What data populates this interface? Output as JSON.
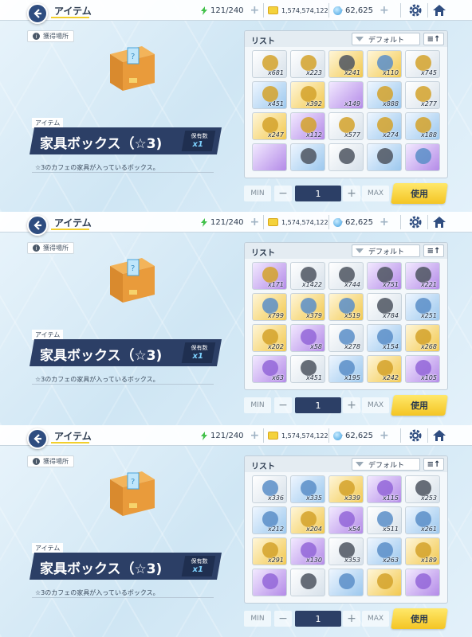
{
  "screens": [
    {
      "title": "アイテム",
      "resources": {
        "ap": "121/240",
        "credits": "1,574,574,122",
        "gems": "62,625"
      },
      "acquisition_label": "獲得場所",
      "item_category": "アイテム",
      "item_name": "家具ボックス（☆3)",
      "owned_label": "保有数",
      "owned_count": "x1",
      "description": "☆3のカフェの家具が入っているボックス。",
      "list_title": "リスト",
      "sort_label": "デフォルト",
      "sort_order_icon": "sort-order-icon",
      "quantity": {
        "min_label": "MIN",
        "max_label": "MAX",
        "value": "1"
      },
      "use_label": "使用",
      "grid": [
        {
          "qty": "x681",
          "tone": "white",
          "glyph": "gold"
        },
        {
          "qty": "x223",
          "tone": "white",
          "glyph": "gold"
        },
        {
          "qty": "x241",
          "tone": "gold",
          "glyph": "dark"
        },
        {
          "qty": "x110",
          "tone": "gold",
          "glyph": "blue"
        },
        {
          "qty": "x745",
          "tone": "white",
          "glyph": "gold"
        },
        {
          "qty": "x451",
          "tone": "blue",
          "glyph": "gold"
        },
        {
          "qty": "x392",
          "tone": "gold",
          "glyph": "gold"
        },
        {
          "qty": "x149",
          "tone": "purple",
          "glyph": "white"
        },
        {
          "qty": "x888",
          "tone": "blue",
          "glyph": "gold"
        },
        {
          "qty": "x277",
          "tone": "white",
          "glyph": "gold"
        },
        {
          "qty": "x247",
          "tone": "gold",
          "glyph": "gold"
        },
        {
          "qty": "x112",
          "tone": "purple",
          "glyph": "gold"
        },
        {
          "qty": "x577",
          "tone": "white",
          "glyph": "gold"
        },
        {
          "qty": "x274",
          "tone": "blue",
          "glyph": "gold"
        },
        {
          "qty": "x188",
          "tone": "blue",
          "glyph": "gold"
        },
        {
          "qty": "",
          "tone": "purple",
          "glyph": "white"
        },
        {
          "qty": "",
          "tone": "blue",
          "glyph": "dark"
        },
        {
          "qty": "",
          "tone": "white",
          "glyph": "dark"
        },
        {
          "qty": "",
          "tone": "blue",
          "glyph": "dark"
        },
        {
          "qty": "",
          "tone": "purple",
          "glyph": "blue"
        }
      ]
    },
    {
      "title": "アイテム",
      "resources": {
        "ap": "121/240",
        "credits": "1,574,574,122",
        "gems": "62,625"
      },
      "acquisition_label": "獲得場所",
      "item_category": "アイテム",
      "item_name": "家具ボックス（☆3)",
      "owned_label": "保有数",
      "owned_count": "x1",
      "description": "☆3のカフェの家具が入っているボックス。",
      "list_title": "リスト",
      "sort_label": "デフォルト",
      "sort_order_icon": "sort-order-icon",
      "quantity": {
        "min_label": "MIN",
        "max_label": "MAX",
        "value": "1"
      },
      "use_label": "使用",
      "grid": [
        {
          "qty": "x171",
          "tone": "purple",
          "glyph": "gold"
        },
        {
          "qty": "x1422",
          "tone": "white",
          "glyph": "dark"
        },
        {
          "qty": "x744",
          "tone": "white",
          "glyph": "dark"
        },
        {
          "qty": "x751",
          "tone": "purple",
          "glyph": "dark"
        },
        {
          "qty": "x221",
          "tone": "purple",
          "glyph": "dark"
        },
        {
          "qty": "x799",
          "tone": "gold",
          "glyph": "blue"
        },
        {
          "qty": "x379",
          "tone": "gold",
          "glyph": "blue"
        },
        {
          "qty": "x519",
          "tone": "gold",
          "glyph": "blue"
        },
        {
          "qty": "x784",
          "tone": "white",
          "glyph": "dark"
        },
        {
          "qty": "x251",
          "tone": "blue",
          "glyph": "blue"
        },
        {
          "qty": "x202",
          "tone": "gold",
          "glyph": "gold"
        },
        {
          "qty": "x58",
          "tone": "purple",
          "glyph": "purple"
        },
        {
          "qty": "x278",
          "tone": "white",
          "glyph": "blue"
        },
        {
          "qty": "x154",
          "tone": "blue",
          "glyph": "blue"
        },
        {
          "qty": "x268",
          "tone": "gold",
          "glyph": "gold"
        },
        {
          "qty": "x63",
          "tone": "purple",
          "glyph": "purple"
        },
        {
          "qty": "x451",
          "tone": "white",
          "glyph": "dark"
        },
        {
          "qty": "x195",
          "tone": "blue",
          "glyph": "blue"
        },
        {
          "qty": "x242",
          "tone": "gold",
          "glyph": "gold"
        },
        {
          "qty": "x105",
          "tone": "purple",
          "glyph": "purple"
        }
      ]
    },
    {
      "title": "アイテム",
      "resources": {
        "ap": "121/240",
        "credits": "1,574,574,122",
        "gems": "62,625"
      },
      "acquisition_label": "獲得場所",
      "item_category": "アイテム",
      "item_name": "家具ボックス（☆3)",
      "owned_label": "保有数",
      "owned_count": "x1",
      "description": "☆3のカフェの家具が入っているボックス。",
      "list_title": "リスト",
      "sort_label": "デフォルト",
      "sort_order_icon": "sort-order-icon",
      "quantity": {
        "min_label": "MIN",
        "max_label": "MAX",
        "value": "1"
      },
      "use_label": "使用",
      "grid": [
        {
          "qty": "x336",
          "tone": "white",
          "glyph": "blue"
        },
        {
          "qty": "x335",
          "tone": "blue",
          "glyph": "blue"
        },
        {
          "qty": "x339",
          "tone": "gold",
          "glyph": "gold"
        },
        {
          "qty": "x115",
          "tone": "purple",
          "glyph": "purple"
        },
        {
          "qty": "x253",
          "tone": "white",
          "glyph": "dark"
        },
        {
          "qty": "x212",
          "tone": "blue",
          "glyph": "blue"
        },
        {
          "qty": "x204",
          "tone": "gold",
          "glyph": "gold"
        },
        {
          "qty": "x54",
          "tone": "purple",
          "glyph": "purple"
        },
        {
          "qty": "x511",
          "tone": "white",
          "glyph": "blue"
        },
        {
          "qty": "x261",
          "tone": "blue",
          "glyph": "blue"
        },
        {
          "qty": "x291",
          "tone": "gold",
          "glyph": "gold"
        },
        {
          "qty": "x130",
          "tone": "purple",
          "glyph": "purple"
        },
        {
          "qty": "x353",
          "tone": "white",
          "glyph": "dark"
        },
        {
          "qty": "x263",
          "tone": "blue",
          "glyph": "blue"
        },
        {
          "qty": "x189",
          "tone": "gold",
          "glyph": "gold"
        },
        {
          "qty": "",
          "tone": "purple",
          "glyph": "purple"
        },
        {
          "qty": "",
          "tone": "white",
          "glyph": "dark"
        },
        {
          "qty": "",
          "tone": "blue",
          "glyph": "blue"
        },
        {
          "qty": "",
          "tone": "gold",
          "glyph": "gold"
        },
        {
          "qty": "",
          "tone": "purple",
          "glyph": "purple"
        }
      ]
    }
  ]
}
